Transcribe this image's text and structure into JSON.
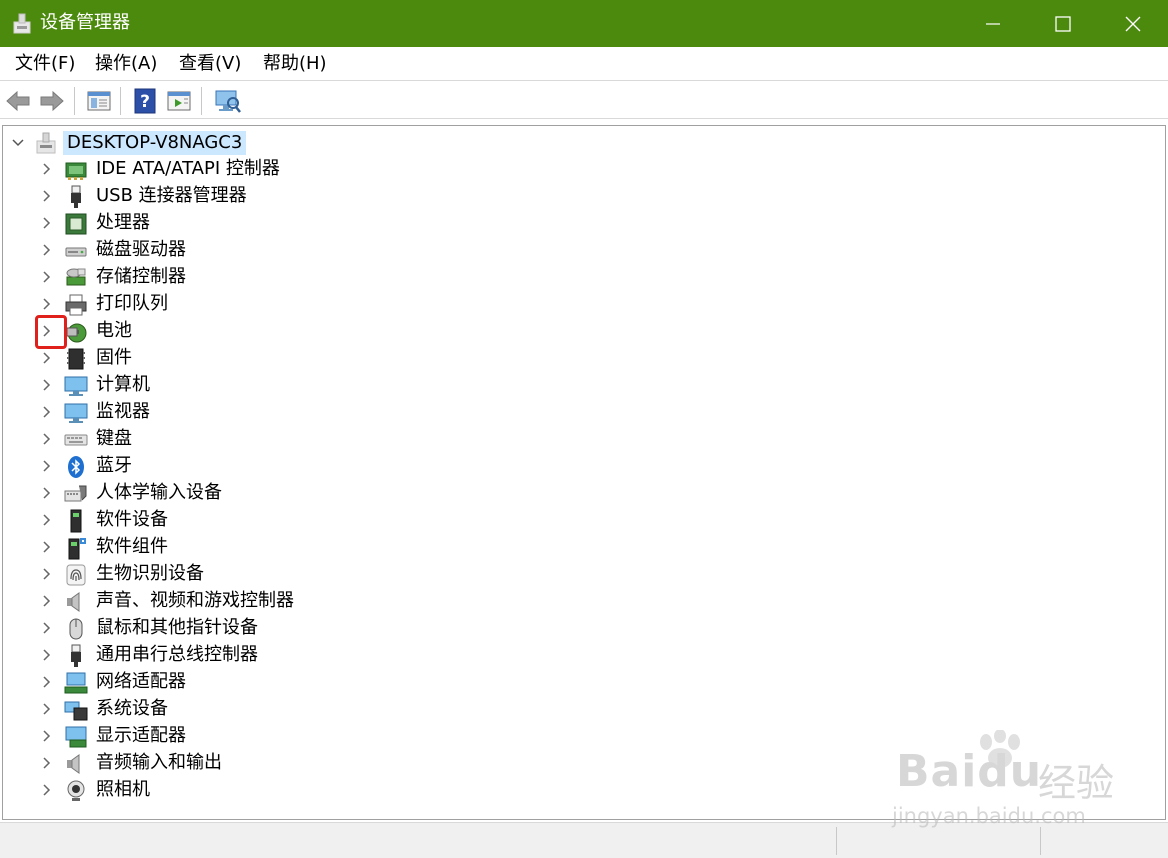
{
  "window": {
    "title": "设备管理器"
  },
  "menu": {
    "items": [
      "文件(F)",
      "操作(A)",
      "查看(V)",
      "帮助(H)"
    ]
  },
  "toolbar": {
    "buttons": [
      "back-arrow-icon",
      "forward-arrow-icon",
      "properties-icon",
      "help-icon",
      "update-driver-icon",
      "scan-hardware-icon"
    ]
  },
  "tree": {
    "root": "DESKTOP-V8NAGC3",
    "items": [
      {
        "label": "IDE ATA/ATAPI 控制器",
        "icon": "ide-controller-icon"
      },
      {
        "label": "USB 连接器管理器",
        "icon": "usb-connector-icon"
      },
      {
        "label": "处理器",
        "icon": "processor-icon"
      },
      {
        "label": "磁盘驱动器",
        "icon": "disk-drive-icon"
      },
      {
        "label": "存储控制器",
        "icon": "storage-controller-icon"
      },
      {
        "label": "打印队列",
        "icon": "printer-icon"
      },
      {
        "label": "电池",
        "icon": "battery-icon"
      },
      {
        "label": "固件",
        "icon": "firmware-icon"
      },
      {
        "label": "计算机",
        "icon": "computer-icon"
      },
      {
        "label": "监视器",
        "icon": "monitor-icon"
      },
      {
        "label": "键盘",
        "icon": "keyboard-icon"
      },
      {
        "label": "蓝牙",
        "icon": "bluetooth-icon"
      },
      {
        "label": "人体学输入设备",
        "icon": "hid-icon"
      },
      {
        "label": "软件设备",
        "icon": "software-device-icon"
      },
      {
        "label": "软件组件",
        "icon": "software-component-icon"
      },
      {
        "label": "生物识别设备",
        "icon": "fingerprint-icon"
      },
      {
        "label": "声音、视频和游戏控制器",
        "icon": "speaker-icon"
      },
      {
        "label": "鼠标和其他指针设备",
        "icon": "mouse-icon"
      },
      {
        "label": "通用串行总线控制器",
        "icon": "usb-controller-icon"
      },
      {
        "label": "网络适配器",
        "icon": "network-adapter-icon"
      },
      {
        "label": "系统设备",
        "icon": "system-device-icon"
      },
      {
        "label": "显示适配器",
        "icon": "display-adapter-icon"
      },
      {
        "label": "音频输入和输出",
        "icon": "audio-io-icon"
      },
      {
        "label": "照相机",
        "icon": "camera-icon"
      }
    ]
  },
  "colors": {
    "titlebar": "#4c8a0e",
    "selection": "#cce8ff",
    "highlight_box": "#e0201a"
  },
  "watermark": {
    "logo": "Baidu",
    "cn": "经验",
    "url": "jingyan.baidu.com"
  }
}
